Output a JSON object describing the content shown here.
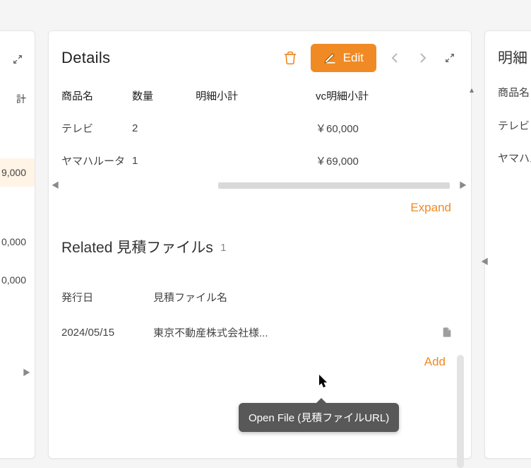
{
  "header": {
    "title": "Details",
    "edit": "Edit"
  },
  "table": {
    "headers": {
      "name": "商品名",
      "qty": "数量",
      "sub": "明細小計",
      "vc": "vc明細小計"
    },
    "rows": [
      {
        "name": "テレビ",
        "qty": "2",
        "sub": "",
        "vc": "￥60,000"
      },
      {
        "name": "ヤマハルータ",
        "qty": "1",
        "sub": "",
        "vc": "￥69,000"
      }
    ],
    "expand": "Expand"
  },
  "related": {
    "title": "Related 見積ファイルs",
    "count": "1",
    "headers": {
      "date": "発行日",
      "file": "見積ファイル名"
    },
    "rows": [
      {
        "date": "2024/05/15",
        "file": "東京不動産株式会社様..."
      }
    ],
    "add": "Add"
  },
  "tooltip": "Open File (見積ファイルURL)",
  "left_panel": {
    "header": "計",
    "values": [
      "9,000",
      "0,000",
      "0,000"
    ]
  },
  "right_panel": {
    "title": "明細",
    "header": "商品名",
    "rows": [
      "テレビ",
      "ヤマハル"
    ]
  }
}
